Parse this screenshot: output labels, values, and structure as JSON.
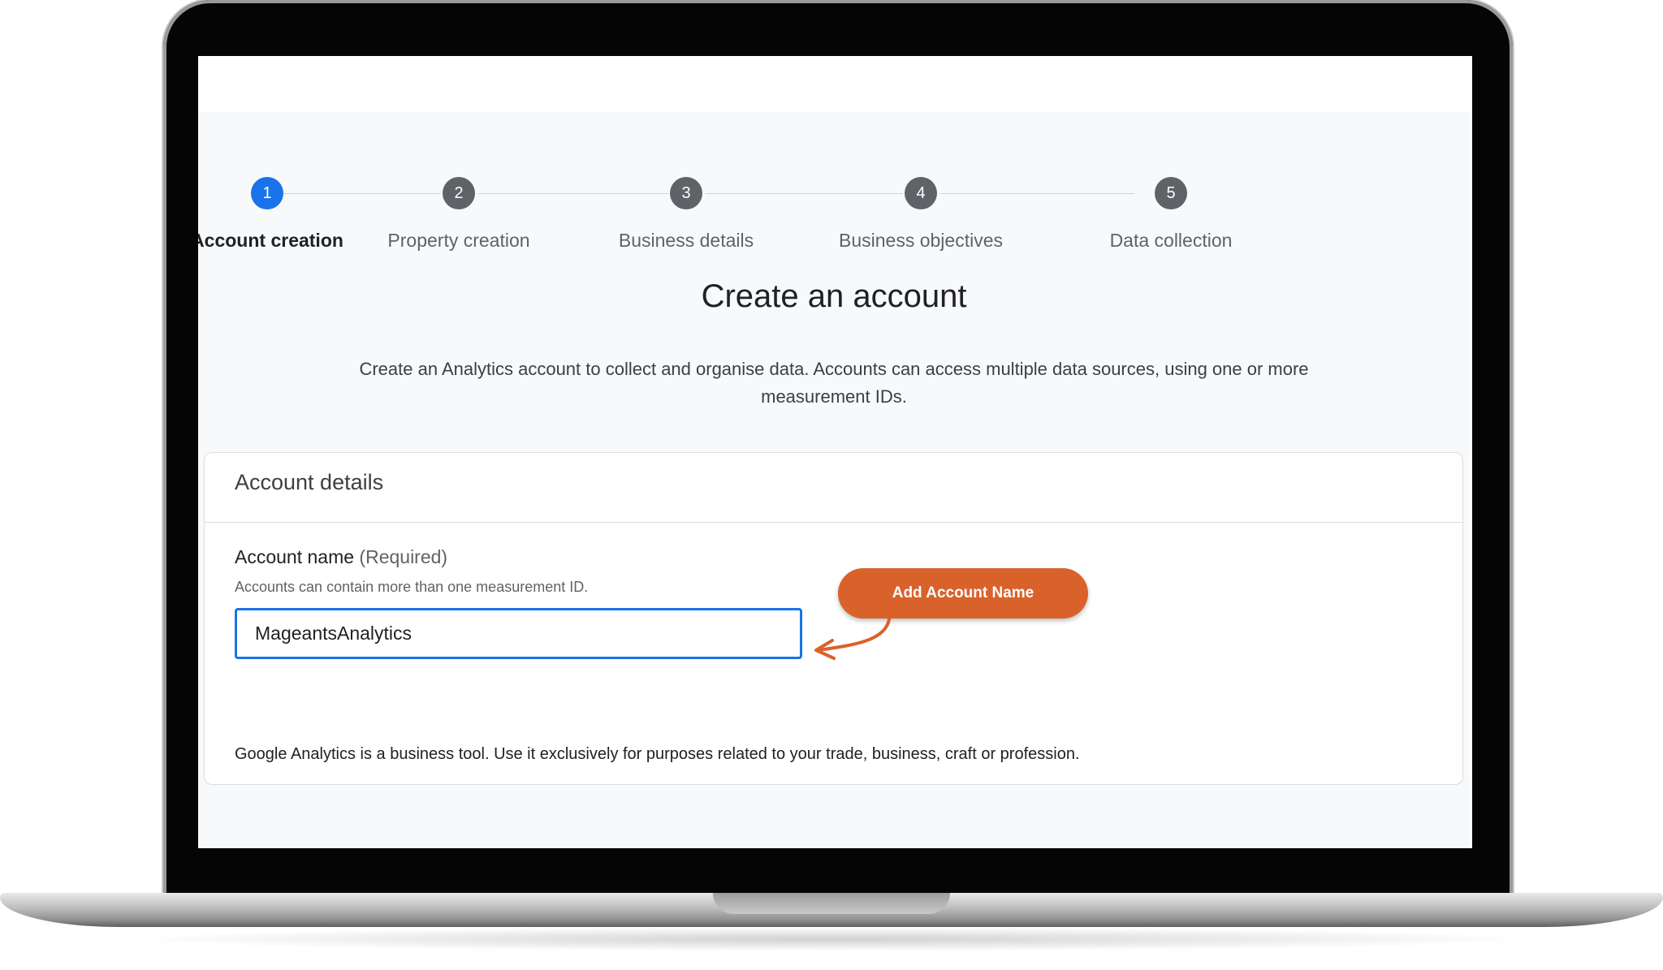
{
  "stepper": {
    "steps": [
      {
        "number": "1",
        "label": "Account creation",
        "state": "active"
      },
      {
        "number": "2",
        "label": "Property creation",
        "state": "upcoming"
      },
      {
        "number": "3",
        "label": "Business details",
        "state": "upcoming"
      },
      {
        "number": "4",
        "label": "Business objectives",
        "state": "upcoming"
      },
      {
        "number": "5",
        "label": "Data collection",
        "state": "upcoming"
      }
    ]
  },
  "page": {
    "title": "Create an account",
    "subtitle": "Create an Analytics account to collect and organise data. Accounts can access multiple data sources, using one or more measurement IDs."
  },
  "card": {
    "header": "Account details",
    "field": {
      "label": "Account name",
      "required_note": "(Required)",
      "help": "Accounts can contain more than one measurement ID.",
      "value": "MageantsAnalytics"
    },
    "footnote": "Google Analytics is a business tool. Use it exclusively for purposes related to your trade, business, craft or profession."
  },
  "callout": {
    "label": "Add Account Name",
    "color": "#d9622b"
  },
  "colors": {
    "accent": "#1a73e8",
    "step_inactive": "#5f6368",
    "background": "#f8f9fa"
  }
}
